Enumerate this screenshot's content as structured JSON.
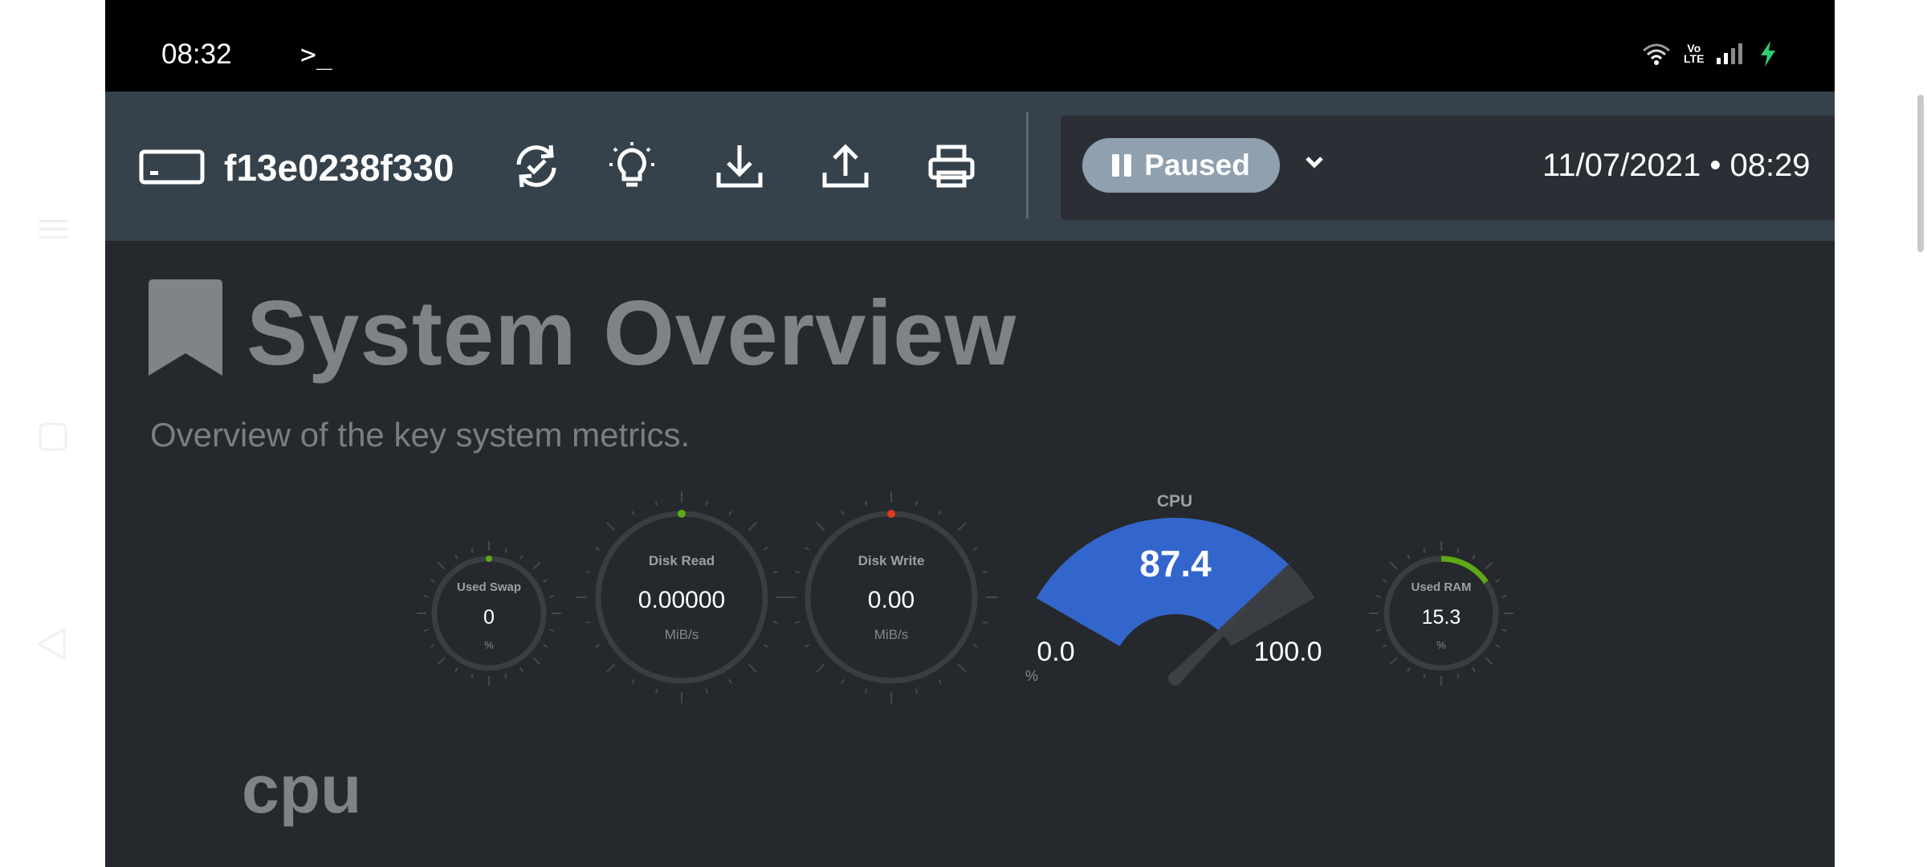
{
  "status_bar": {
    "time": "08:32",
    "terminal_glyph": ">_",
    "network_label_top": "Vo",
    "network_label_bottom": "LTE",
    "icons": [
      "wifi-icon",
      "volte-icon",
      "signal-icon",
      "charging-icon"
    ]
  },
  "toolbar": {
    "hostname": "f13e0238f330",
    "icons": [
      "server-icon",
      "refresh-icon",
      "lightbulb-icon",
      "download-icon",
      "upload-icon",
      "print-icon"
    ],
    "playback_state": "Paused",
    "datetime": "11/07/2021 • 08:29"
  },
  "page": {
    "title": "System Overview",
    "subtitle": "Overview of the key system metrics.",
    "section_heading": "cpu"
  },
  "gauges": {
    "used_swap": {
      "title": "Used Swap",
      "value": "0",
      "unit": "%",
      "level": 0.0
    },
    "disk_read": {
      "title": "Disk Read",
      "value": "0.00000",
      "unit": "MiB/s"
    },
    "disk_write": {
      "title": "Disk Write",
      "value": "0.00",
      "unit": "MiB/s"
    },
    "cpu": {
      "title": "CPU",
      "value": "87.4",
      "min": "0.0",
      "max": "100.0",
      "unit": "%",
      "level": 0.874
    },
    "used_ram": {
      "title": "Used RAM",
      "value": "15.3",
      "unit": "%",
      "level": 0.153
    }
  },
  "colors": {
    "toolbar_bg": "#35424c",
    "main_bg": "#25282c",
    "cpu_fill": "#3366cc",
    "ok_green": "#5fa915",
    "alert_red": "#e2391b",
    "paused_pill": "#8fa0ae"
  }
}
